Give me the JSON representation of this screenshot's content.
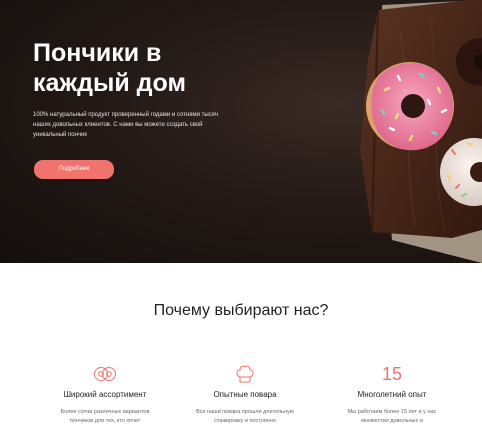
{
  "hero": {
    "title": "Пончики в каждый дом",
    "text": "100% натуральный продукт проверенный годами и сотнями тысяч наших довольных клиентов. С нами вы можете создать свой уникальный пончик",
    "button_label": "Подробнее"
  },
  "why": {
    "title": "Почему выбирают нас?",
    "features": [
      {
        "icon": "donut-icon",
        "title": "Широкий ассортимент",
        "text": "Более сотни различных вариантов пончиков для тех, кто хочет"
      },
      {
        "icon": "chef-hat-icon",
        "title": "Опытные повара",
        "text": "Все наши повара прошли длительную стажировку и постоянно"
      },
      {
        "icon_text": "15",
        "title": "Многолетний опыт",
        "text": "Мы работаем более 15 лет и у нас множество довольных и"
      }
    ]
  },
  "colors": {
    "accent": "#f0746d",
    "hero_bg": "#1e1614"
  }
}
